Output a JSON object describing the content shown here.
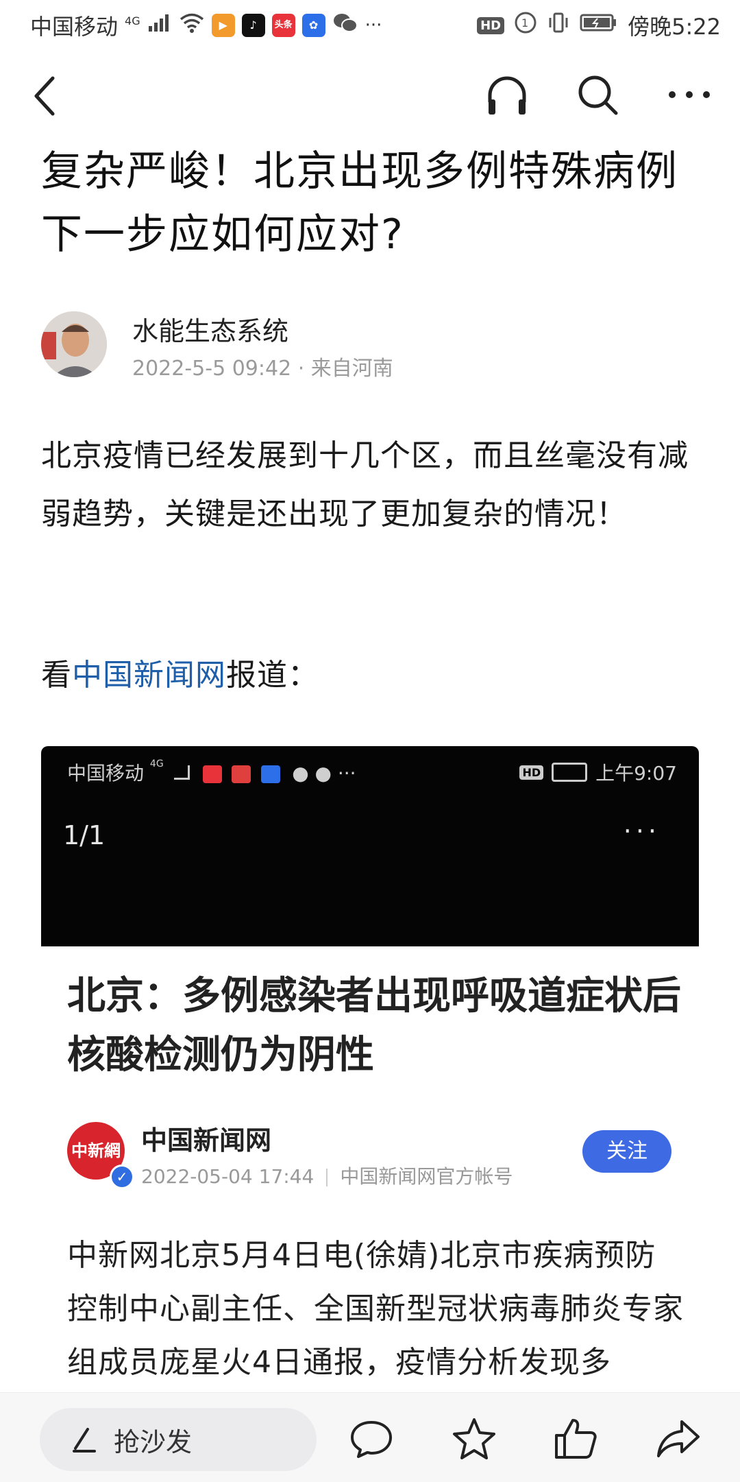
{
  "status_bar": {
    "carrier": "中国移动",
    "network": "4G",
    "time": "傍晚5:22",
    "hd": "HD",
    "more": "···"
  },
  "nav": {
    "back_icon": "chevron-left-icon",
    "listen_icon": "headphones-icon",
    "search_icon": "search-icon",
    "more_icon": "more-horizontal-icon"
  },
  "article": {
    "title": "复杂严峻！北京出现多例特殊病例下一步应如何应对?",
    "author": "水能生态系统",
    "meta": "2022-5-5 09:42 · 来自河南",
    "paragraph1": "北京疫情已经发展到十几个区，而且丝毫没有减弱趋势，关键是还出现了更加复杂的情况！",
    "paragraph2_prefix": "看",
    "paragraph2_link": "中国新闻网",
    "paragraph2_suffix": "报道："
  },
  "embedded": {
    "status_carrier": "中国移动",
    "status_time": "上午9:07",
    "pager": "1/1",
    "more": "···",
    "headline": "北京：多例感染者出现呼吸道症状后核酸检测仍为阴性",
    "source_name": "中国新闻网",
    "source_date": "2022-05-04 17:44",
    "source_desc": "中国新闻网官方帐号",
    "follow_label": "关注",
    "body": "中新网北京5月4日电(徐婧)北京市疾病预防控制中心副主任、全国新型冠状病毒肺炎专家组成员庞星火4日通报，疫情分析发现多"
  },
  "bottom_bar": {
    "comment_placeholder": "抢沙发",
    "icons": [
      "edit-icon",
      "comment-icon",
      "star-icon",
      "like-icon",
      "share-icon"
    ]
  }
}
